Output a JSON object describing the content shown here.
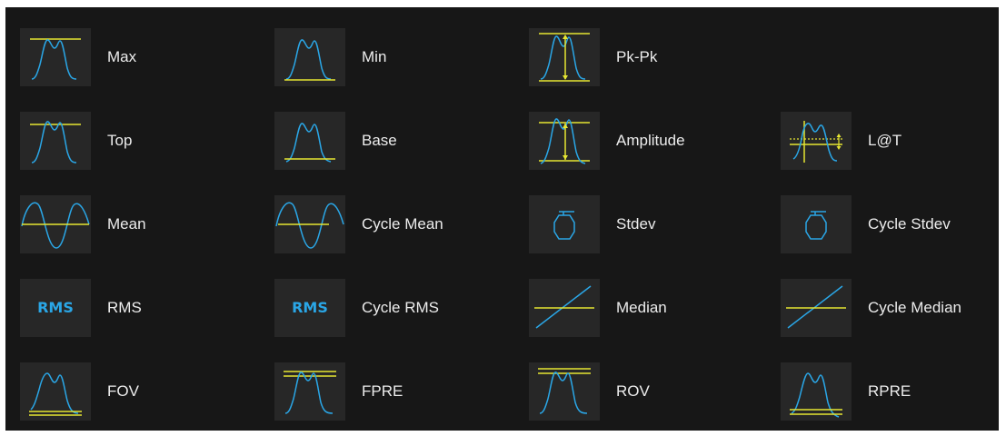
{
  "colors": {
    "background": "#171717",
    "icon_background": "#272727",
    "waveform": "#2aa6e6",
    "reference_line": "#e6e632",
    "label": "#ececec"
  },
  "measurements": [
    {
      "label": "Max",
      "icon": "max-icon"
    },
    {
      "label": "Min",
      "icon": "min-icon"
    },
    {
      "label": "Pk-Pk",
      "icon": "pk-pk-icon"
    },
    {
      "label": "Top",
      "icon": "top-icon"
    },
    {
      "label": "Base",
      "icon": "base-icon"
    },
    {
      "label": "Amplitude",
      "icon": "amplitude-icon"
    },
    {
      "label": "L@T",
      "icon": "level-at-time-icon"
    },
    {
      "label": "Mean",
      "icon": "mean-icon"
    },
    {
      "label": "Cycle Mean",
      "icon": "cycle-mean-icon"
    },
    {
      "label": "Stdev",
      "icon": "stdev-icon"
    },
    {
      "label": "Cycle Stdev",
      "icon": "cycle-stdev-icon"
    },
    {
      "label": "RMS",
      "icon": "rms-icon",
      "icon_text": "RMS"
    },
    {
      "label": "Cycle RMS",
      "icon": "cycle-rms-icon",
      "icon_text": "RMS"
    },
    {
      "label": "Median",
      "icon": "median-icon"
    },
    {
      "label": "Cycle Median",
      "icon": "cycle-median-icon"
    },
    {
      "label": "FOV",
      "icon": "fov-icon"
    },
    {
      "label": "FPRE",
      "icon": "fpre-icon"
    },
    {
      "label": "ROV",
      "icon": "rov-icon"
    },
    {
      "label": "RPRE",
      "icon": "rpre-icon"
    }
  ]
}
